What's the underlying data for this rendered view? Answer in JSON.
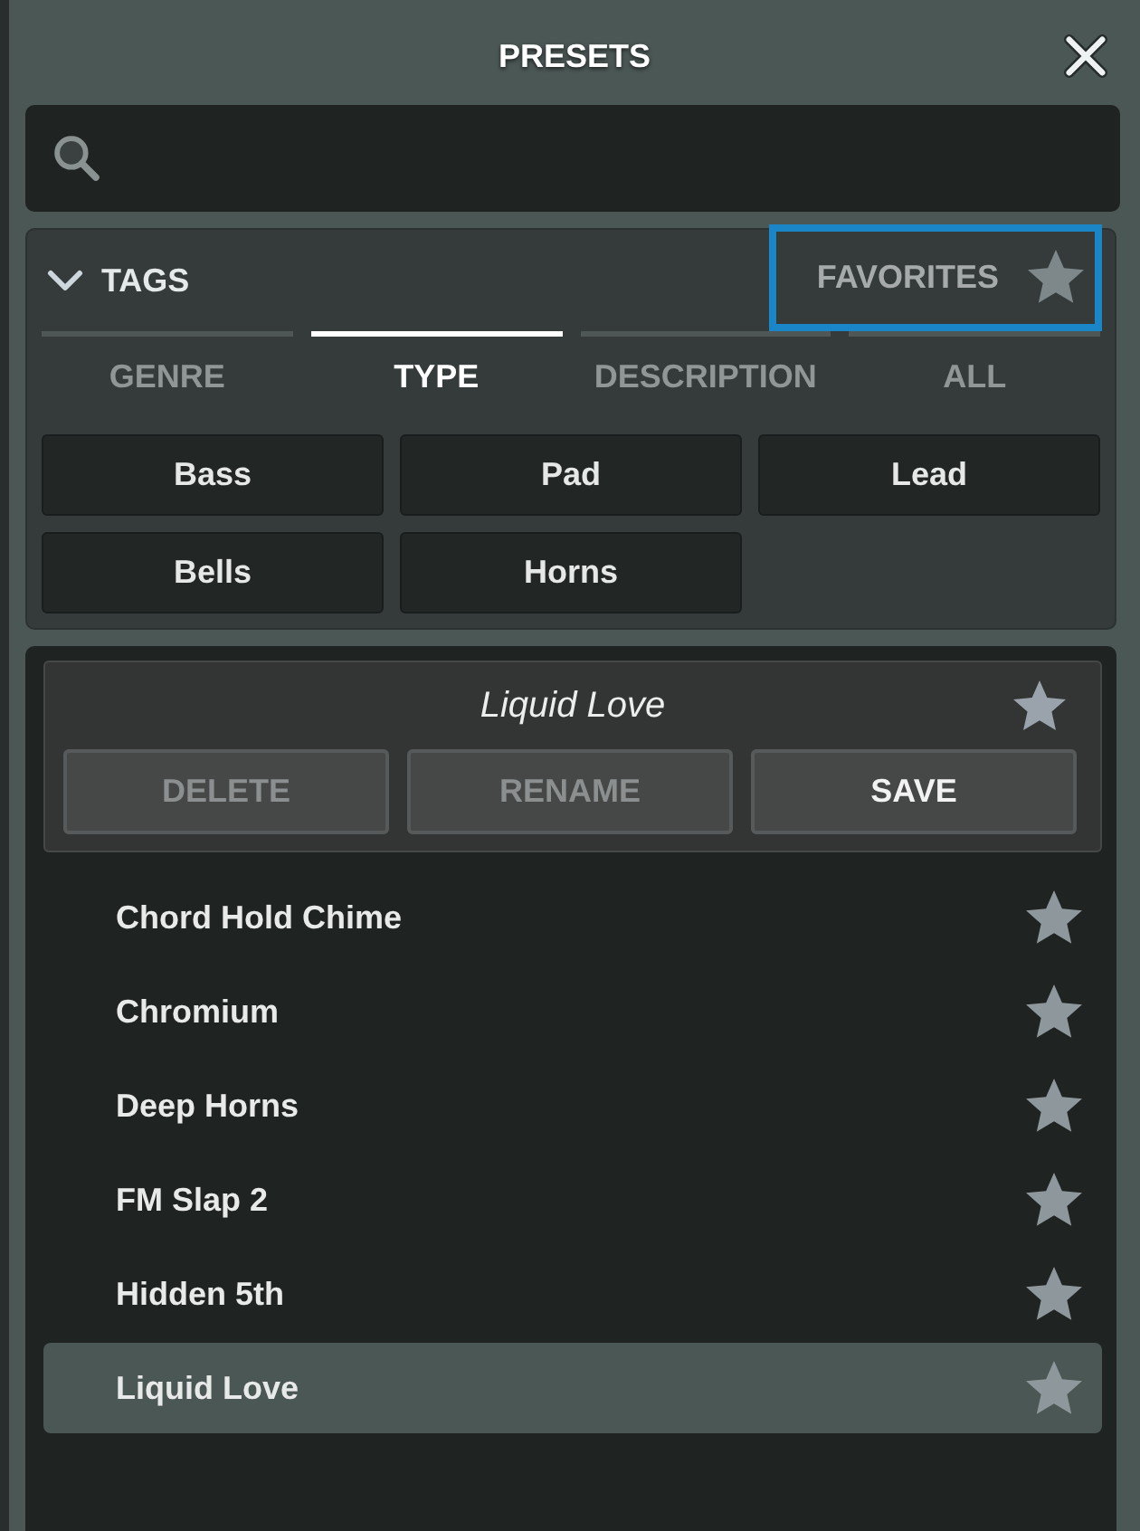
{
  "window": {
    "title": "PRESETS"
  },
  "tags": {
    "title": "TAGS",
    "expanded": true,
    "favorites": {
      "label": "FAVORITES",
      "highlighted": true
    },
    "tabs": [
      {
        "label": "GENRE",
        "selected": false
      },
      {
        "label": "TYPE",
        "selected": true
      },
      {
        "label": "DESCRIPTION",
        "selected": false
      },
      {
        "label": "ALL",
        "selected": false
      }
    ],
    "tag_buttons": [
      "Bass",
      "Pad",
      "Lead",
      "Bells",
      "Horns"
    ]
  },
  "current_preset": {
    "name": "Liquid Love",
    "buttons": [
      {
        "label": "DELETE",
        "disabled": true
      },
      {
        "label": "RENAME",
        "disabled": true
      },
      {
        "label": "SAVE",
        "disabled": false
      }
    ]
  },
  "presets": [
    {
      "name": "Chord Hold Chime",
      "selected": false
    },
    {
      "name": "Chromium",
      "selected": false
    },
    {
      "name": "Deep Horns",
      "selected": false
    },
    {
      "name": "FM Slap 2",
      "selected": false
    },
    {
      "name": "Hidden 5th",
      "selected": false
    },
    {
      "name": "Liquid Love",
      "selected": true
    }
  ]
}
